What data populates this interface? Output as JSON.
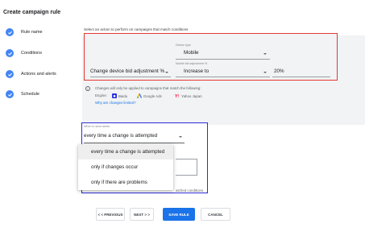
{
  "page": {
    "title": "Create campaign rule"
  },
  "steps": [
    {
      "label": "Rule name"
    },
    {
      "label": "Conditions"
    },
    {
      "label": "Actions and alerts"
    },
    {
      "label": "Schedule"
    }
  ],
  "action": {
    "instruction": "Select an action to perform on campaigns that match conditions",
    "device_type": {
      "label": "Device type",
      "value": "Mobile"
    },
    "action_type": {
      "value": "Change device bid adjustment %"
    },
    "adjustment": {
      "label": "Mobile bid adjustment %",
      "direction": "Increase to",
      "amount": "20%"
    },
    "info_text": "Changes will only be applied to campaigns that match the following:",
    "engine_label": "Engine:",
    "engines": [
      {
        "name": "Baidu",
        "icon": "baidu-icon"
      },
      {
        "name": "Google Ads",
        "icon": "google-ads-icon"
      },
      {
        "name": "Yahoo Japan",
        "icon": "yahoo-japan-icon"
      }
    ],
    "why_link": "Why are changes limited?"
  },
  "alerts": {
    "label": "When to send alerts:",
    "value": "every time a change is attempted",
    "options": [
      "every time a change is attempted",
      "only if changes occur",
      "only if there are problems"
    ],
    "behind_text": "atched conditions"
  },
  "buttons": {
    "previous": "< < PREVIOUS",
    "next": "NEXT > >",
    "save": "SAVE RULE",
    "cancel": "CANCEL"
  },
  "colors": {
    "accent": "#1a73e8",
    "step_icon": "#4285f4",
    "highlight_red": "#e53935",
    "highlight_blue": "#2b2bd6"
  }
}
